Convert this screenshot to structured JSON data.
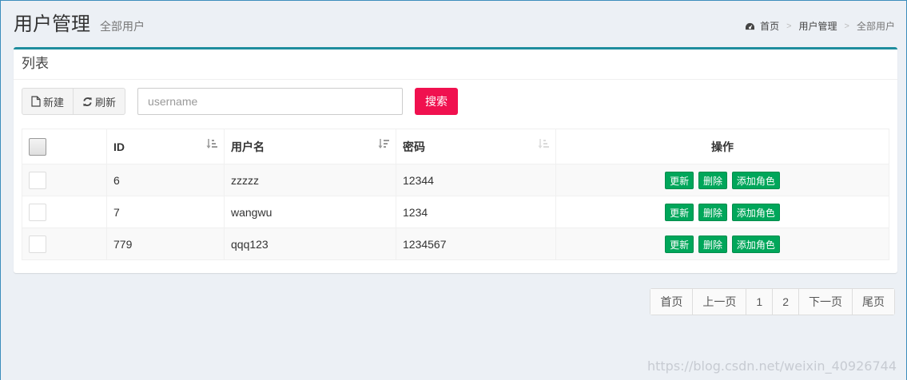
{
  "header": {
    "title": "用户管理",
    "subtitle": "全部用户",
    "breadcrumb": [
      "首页",
      "用户管理",
      "全部用户"
    ],
    "breadcrumb_sep": ">"
  },
  "box": {
    "title": "列表"
  },
  "toolbar": {
    "new_label": "新建",
    "refresh_label": "刷新",
    "search_placeholder": "username",
    "search_label": "搜索"
  },
  "table": {
    "columns": [
      "ID",
      "用户名",
      "密码",
      "操作"
    ],
    "rows": [
      {
        "id": "6",
        "username": "zzzzz",
        "password": "12344"
      },
      {
        "id": "7",
        "username": "wangwu",
        "password": "1234"
      },
      {
        "id": "779",
        "username": "qqq123",
        "password": "1234567"
      }
    ],
    "actions": [
      "更新",
      "删除",
      "添加角色"
    ]
  },
  "pagination": [
    "首页",
    "上一页",
    "1",
    "2",
    "下一页",
    "尾页"
  ],
  "watermark": "https://blog.csdn.net/weixin_40926744",
  "colors": {
    "accent": "#1f8d9e",
    "search_button": "#f0114f",
    "action_button": "#00a65a",
    "background": "#ecf0f5"
  }
}
